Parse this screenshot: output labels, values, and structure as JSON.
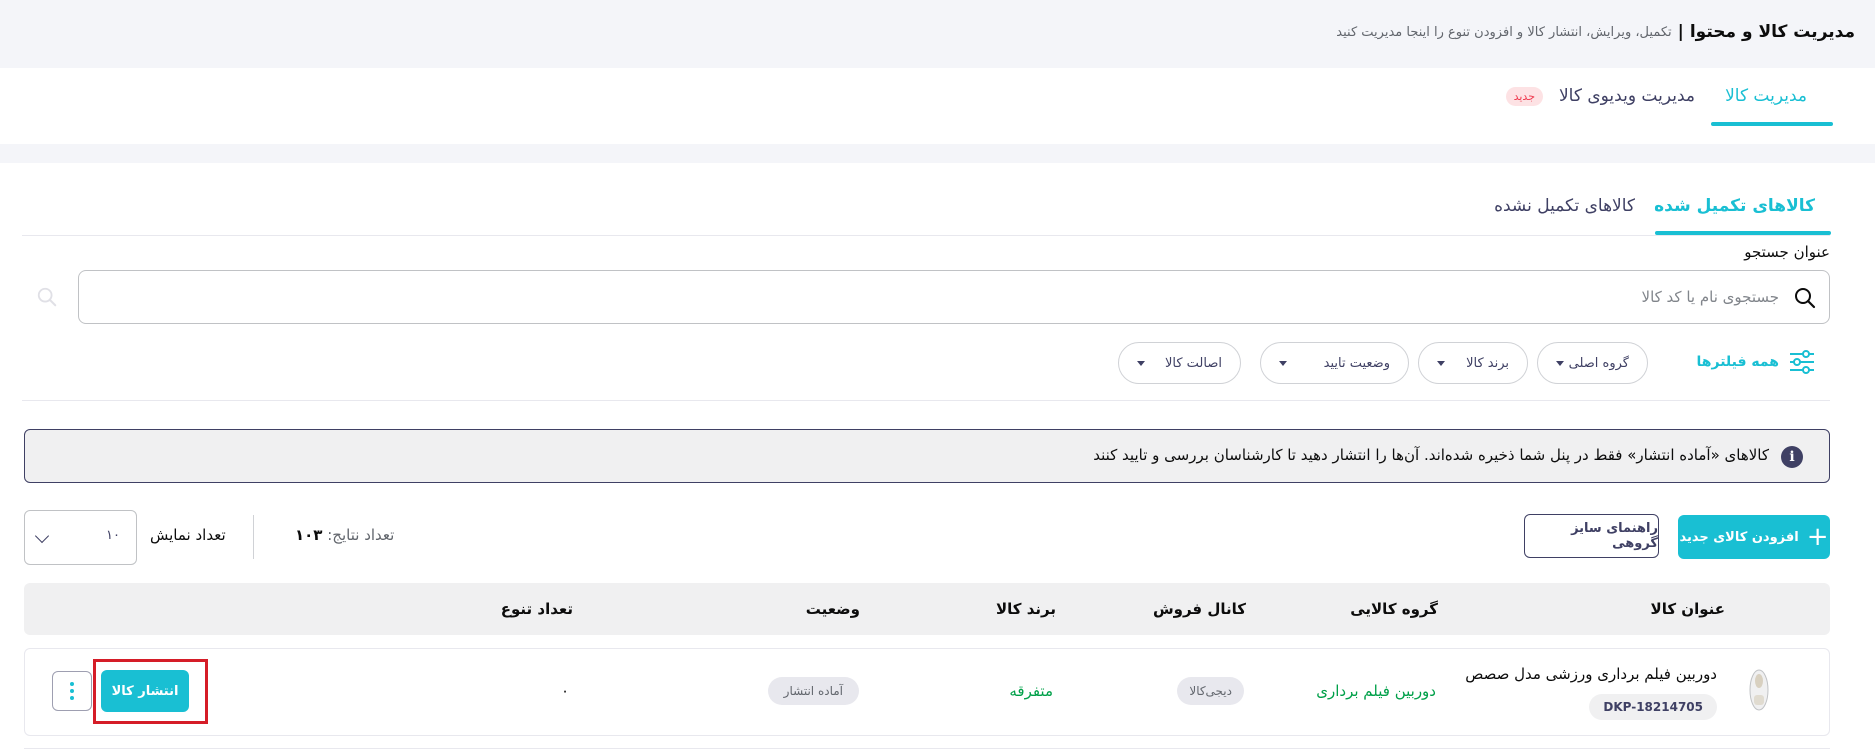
{
  "header": {
    "title": "مدیریت کالا و محتوا",
    "separator": "|",
    "subtitle": "تکمیل، ویرایش، انتشار کالا و افزودن تنوع را اینجا مدیریت کنید"
  },
  "top_tabs": [
    {
      "label": "مدیریت کالا",
      "active": true
    },
    {
      "label": "مدیریت ویدیوی کالا",
      "active": false,
      "badge": "جدید"
    }
  ],
  "sub_tabs": [
    {
      "label": "کالاهای تکمیل شده",
      "active": true
    },
    {
      "label": "کالاهای تکمیل نشده",
      "active": false
    }
  ],
  "search": {
    "label": "عنوان جستجو",
    "placeholder": "جستجوی نام یا کد کالا",
    "value": ""
  },
  "filters": {
    "all_label": "همه فیلترها",
    "items": [
      {
        "label": "گروه اصلی"
      },
      {
        "label": "برند کالا"
      },
      {
        "label": "وضعیت تایید"
      },
      {
        "label": "اصالت کالا"
      }
    ]
  },
  "info": {
    "text": "کالاهای «آماده انتشار» فقط در پنل شما ذخیره شده‌اند. آن‌ها را انتشار دهید تا کارشناسان بررسی و تایید کنند"
  },
  "toolbar": {
    "add_label": "افزودن کالای جدید",
    "guide_label": "راهنمای سایز گروهی",
    "results_label": "تعداد نتایج:",
    "results_count": "۱۰۳",
    "display_label": "تعداد نمایش",
    "display_value": "۱۰"
  },
  "table": {
    "columns": [
      "عنوان کالا",
      "گروه کالایی",
      "کانال فروش",
      "برند کالا",
      "وضعیت",
      "تعداد تنوع"
    ],
    "rows": [
      {
        "title": "دوربین فیلم برداری ورزشی مدل صصص",
        "sku": "DKP-18214705",
        "category": "دوربین فیلم برداری",
        "channel": "دیجی‌کالا",
        "brand": "متفرقه",
        "status": "آماده انتشار",
        "variety_count": "۰",
        "publish_label": "انتشار کالا"
      }
    ]
  },
  "colors": {
    "accent": "#19bfd3",
    "link_green": "#00a049",
    "badge_red": "#ef394e",
    "highlight_red": "#d51d28"
  }
}
